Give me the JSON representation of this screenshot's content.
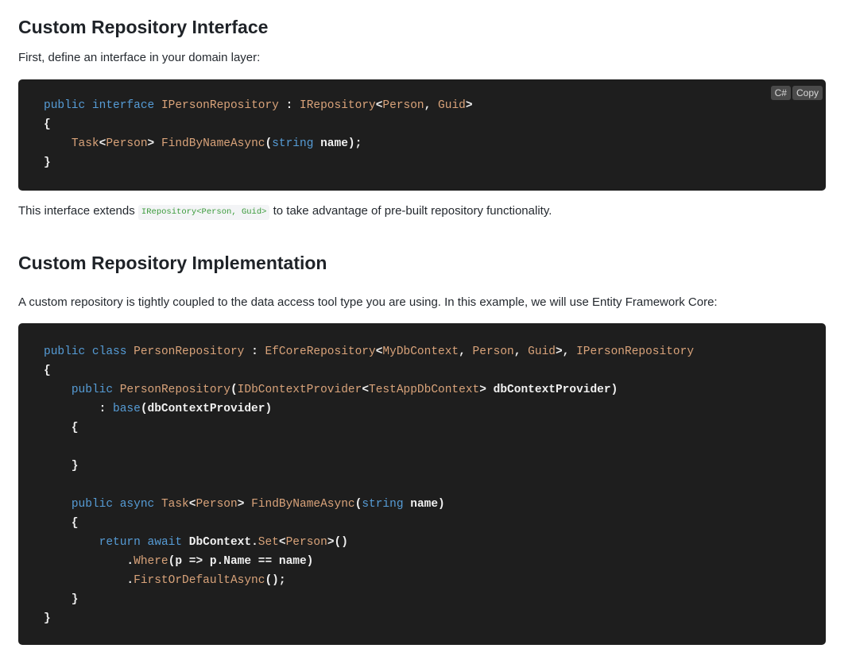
{
  "section1": {
    "title": "Custom Repository Interface",
    "intro": "First, define an interface in your domain layer:",
    "code_language": "C#",
    "copy_label": "Copy",
    "after_prefix": "This interface extends ",
    "after_code": "IRepository<Person, Guid>",
    "after_suffix": " to take advantage of pre-built repository functionality."
  },
  "section2": {
    "title": "Custom Repository Implementation",
    "intro": "A custom repository is tightly coupled to the data access tool type you are using. In this example, we will use Entity Framework Core:"
  },
  "code1": {
    "l1": {
      "a": "public",
      "b": " ",
      "c": "interface",
      "d": " ",
      "e": "IPersonRepository",
      "f": " : ",
      "g": "IRepository",
      "h": "<",
      "i": "Person",
      "j": ", ",
      "k": "Guid",
      "l": ">"
    },
    "l2": "{",
    "l3": {
      "a": "    ",
      "b": "Task",
      "c": "<",
      "d": "Person",
      "e": "> ",
      "f": "FindByNameAsync",
      "g": "(",
      "h": "string",
      "i": " name);"
    },
    "l4": "}"
  },
  "code2": {
    "l1": {
      "a": "public",
      "b": " ",
      "c": "class",
      "d": " ",
      "e": "PersonRepository",
      "f": " : ",
      "g": "EfCoreRepository",
      "h": "<",
      "i": "MyDbContext",
      "j": ", ",
      "k": "Person",
      "l": ", ",
      "m": "Guid",
      "n": ">, ",
      "o": "IPersonRepository"
    },
    "l2": "{",
    "l3": {
      "a": "    ",
      "b": "public",
      "c": " ",
      "d": "PersonRepository",
      "e": "(",
      "f": "IDbContextProvider",
      "g": "<",
      "h": "TestAppDbContext",
      "i": "> dbContextProvider)"
    },
    "l4": {
      "a": "        : ",
      "b": "base",
      "c": "(dbContextProvider)"
    },
    "l5": "    {",
    "l6": "",
    "l7": "    }",
    "l8": "",
    "l9": {
      "a": "    ",
      "b": "public",
      "c": " ",
      "d": "async",
      "e": " ",
      "f": "Task",
      "g": "<",
      "h": "Person",
      "i": "> ",
      "j": "FindByNameAsync",
      "k": "(",
      "l": "string",
      "m": " name)"
    },
    "l10": "    {",
    "l11": {
      "a": "        ",
      "b": "return",
      "c": " ",
      "d": "await",
      "e": " DbContext.",
      "f": "Set",
      "g": "<",
      "h": "Person",
      "i": ">()"
    },
    "l12": {
      "a": "            .",
      "b": "Where",
      "c": "(p => p.Name == name)"
    },
    "l13": {
      "a": "            .",
      "b": "FirstOrDefaultAsync",
      "c": "();"
    },
    "l14": "    }",
    "l15": "}"
  }
}
